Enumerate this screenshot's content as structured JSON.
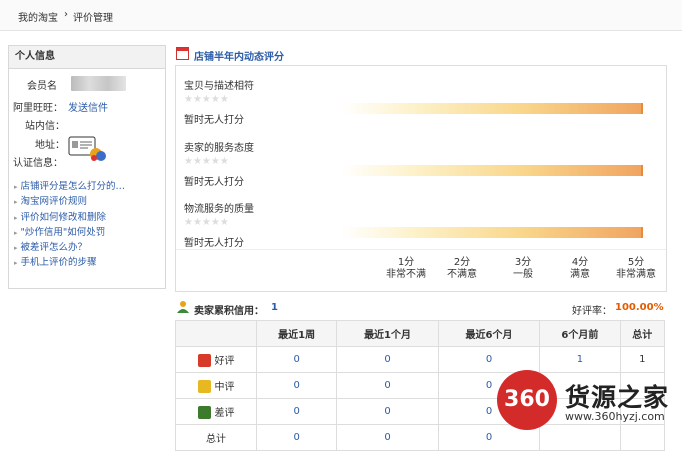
{
  "breadcrumb": {
    "home": "我的淘宝",
    "separator": "›",
    "current": "评价管理"
  },
  "sidebar": {
    "title": "个人信息",
    "member_label": "会员名",
    "aliwangwang_label": "阿里旺旺：",
    "aliwangwang_link": "发送信件",
    "station_label": "站内信：",
    "address_label": "地址：",
    "verify_label": "认证信息：",
    "links": [
      "店铺评分是怎么打分的…",
      "淘宝网评价规则",
      "评价如何修改和删除",
      "\"炒作信用\"如何处罚",
      "被差评怎么办？",
      "手机上评价的步骤"
    ]
  },
  "rating": {
    "title": "店铺半年内动态评分",
    "items": [
      {
        "label": "宝贝与描述相符",
        "stars": "★★★★★",
        "status": "暂时无人打分"
      },
      {
        "label": "卖家的服务态度",
        "stars": "★★★★★",
        "status": "暂时无人打分"
      },
      {
        "label": "物流服务的质量",
        "stars": "★★★★★",
        "status": "暂时无人打分"
      }
    ],
    "scale": [
      {
        "score": "1分",
        "desc": "非常不满"
      },
      {
        "score": "2分",
        "desc": "不满意"
      },
      {
        "score": "3分",
        "desc": "一般"
      },
      {
        "score": "4分",
        "desc": "满意"
      },
      {
        "score": "5分",
        "desc": "非常满意"
      }
    ]
  },
  "credit": {
    "label": "卖家累积信用：",
    "value": "1",
    "good_rate_label": "好评率：",
    "good_rate_value": "100.00%"
  },
  "table": {
    "headers": [
      "",
      "最近1周",
      "最近1个月",
      "最近6个月",
      "6个月前",
      "总计"
    ],
    "rows": [
      {
        "label": "好评",
        "icon": "flower-icon",
        "values": [
          "0",
          "0",
          "0",
          "1",
          "1"
        ]
      },
      {
        "label": "中评",
        "icon": "neutral-icon",
        "values": [
          "0",
          "0",
          "0",
          "",
          ""
        ]
      },
      {
        "label": "差评",
        "icon": "bad-icon",
        "values": [
          "0",
          "0",
          "0",
          "",
          ""
        ]
      },
      {
        "label": "总计",
        "icon": "",
        "values": [
          "0",
          "0",
          "0",
          "",
          ""
        ]
      }
    ]
  },
  "watermark": {
    "logo": "360",
    "brand": "货源之家",
    "url": "www.360hyzj.com"
  },
  "colors": {
    "link": "#2c5ca8",
    "accent": "#e35b00",
    "logo_red": "#d32a2a"
  }
}
